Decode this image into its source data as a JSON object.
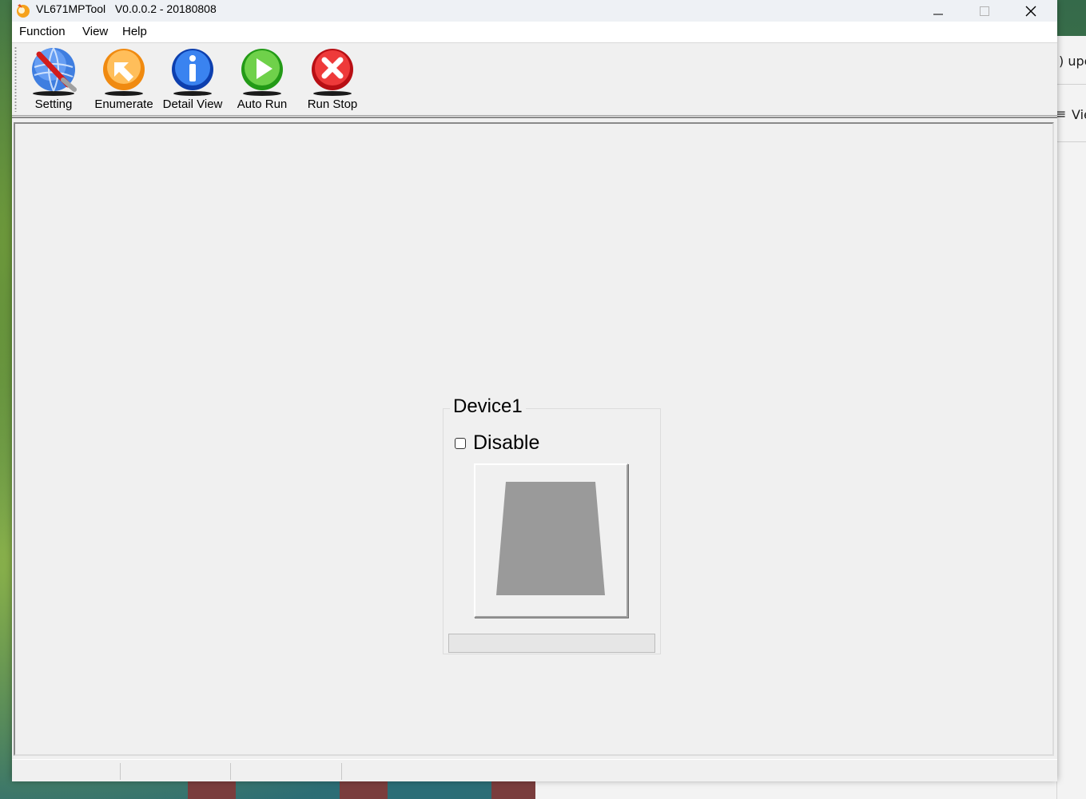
{
  "window": {
    "title": "VL671MPTool",
    "version": "V0.0.0.2 - 20180808"
  },
  "menu": {
    "items": [
      "Function",
      "View",
      "Help"
    ]
  },
  "toolbar": {
    "buttons": [
      {
        "label": "Setting",
        "icon": "setting-globe-wrench-icon",
        "color": "#2f6fd6"
      },
      {
        "label": "Enumerate",
        "icon": "enumerate-arrow-icon",
        "color": "#f39a1e"
      },
      {
        "label": "Detail View",
        "icon": "info-icon",
        "color": "#1d5fd0"
      },
      {
        "label": "Auto Run",
        "icon": "play-icon",
        "color": "#35b526"
      },
      {
        "label": "Run Stop",
        "icon": "stop-x-icon",
        "color": "#e2222b"
      }
    ]
  },
  "device": {
    "title": "Device1",
    "disable_label": "Disable",
    "disable_checked": false,
    "progress": 0,
    "state_icon": "usb-device-shape-icon",
    "shape_color": "#9a9a9a"
  },
  "background_window": {
    "fragment_1": ") upc",
    "fragment_2": "Vie"
  }
}
